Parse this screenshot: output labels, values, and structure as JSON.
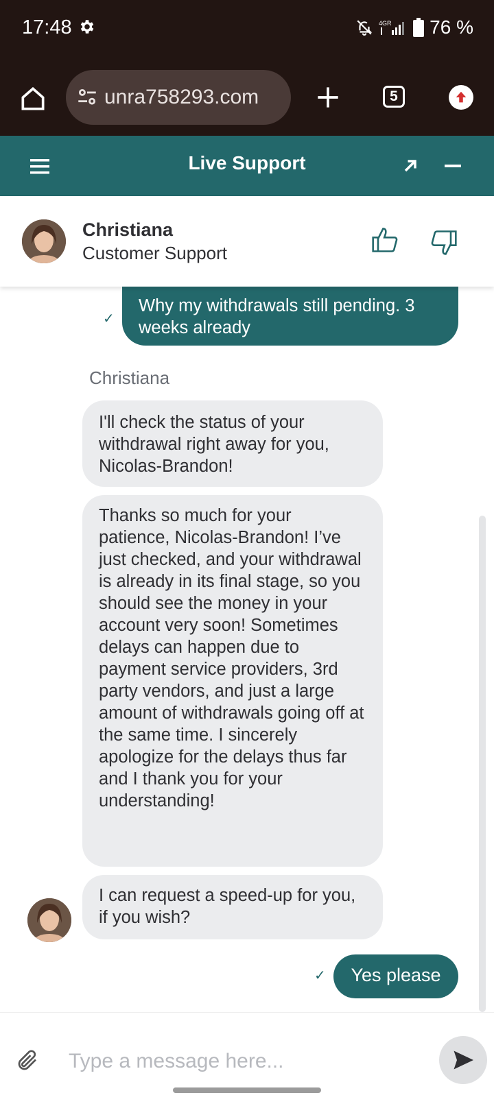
{
  "status_bar": {
    "time": "17:48",
    "battery": "76 %",
    "icons": [
      "gear-icon",
      "bell-off-icon",
      "network-4g-icon",
      "signal-icon",
      "battery-icon"
    ]
  },
  "browser": {
    "url": "unra758293.com",
    "tab_count": "5",
    "icons": [
      "home-icon",
      "site-settings-icon",
      "plus-icon",
      "update-icon"
    ]
  },
  "header": {
    "title": "Live Support",
    "icons": [
      "menu-icon",
      "expand-icon",
      "minimize-icon"
    ]
  },
  "agent": {
    "name": "Christiana",
    "role": "Customer Support"
  },
  "messages": [
    {
      "from": "user",
      "text": "Why my withdrawals still pending. 3 weeks already",
      "status": "✓"
    },
    {
      "from": "agent",
      "text": "I'll check the status of your withdrawal right away for you, Nicolas-Brandon!"
    },
    {
      "from": "agent",
      "text": "Thanks so much for your patience, Nicolas-Brandon! I’ve just checked, and your withdrawal is already in its final stage, so you should see the money in your account very soon! Sometimes delays can happen due to payment service providers, 3rd party vendors, and just a large amount of withdrawals going off at the same time. I sincerely apologize for the delays thus far and I thank you for your understanding!"
    },
    {
      "from": "agent",
      "text": "I can request a speed-up for you, if you wish?"
    },
    {
      "from": "user",
      "text": "Yes please",
      "status": "✓"
    }
  ],
  "sender_label": "Christiana",
  "composer": {
    "placeholder": "Type a message here...",
    "value": ""
  },
  "colors": {
    "brand": "#23686b",
    "browser_chrome": "#221512",
    "incoming_bubble": "#ebecee"
  }
}
